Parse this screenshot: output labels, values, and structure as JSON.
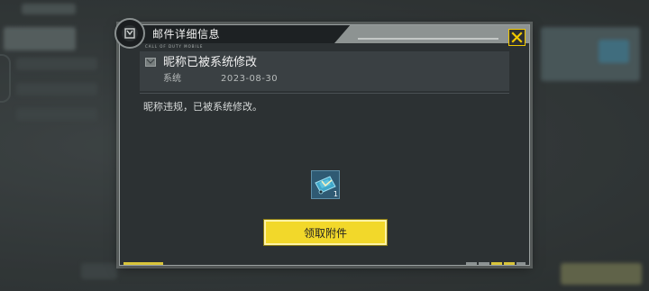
{
  "dialog": {
    "title": "邮件详细信息",
    "brand_text": "CALL OF DUTY MOBILE"
  },
  "mail": {
    "subject": "昵称已被系统修改",
    "sender": "系统",
    "date": "2023-08-30",
    "body": "昵称违规，已被系统修改。"
  },
  "attachment": {
    "icon": "ticket-card-icon",
    "count": "1"
  },
  "actions": {
    "claim_label": "领取附件"
  },
  "colors": {
    "accent": "#f2d82a",
    "panel": "#2c3133",
    "close_border": "#f0c800"
  }
}
